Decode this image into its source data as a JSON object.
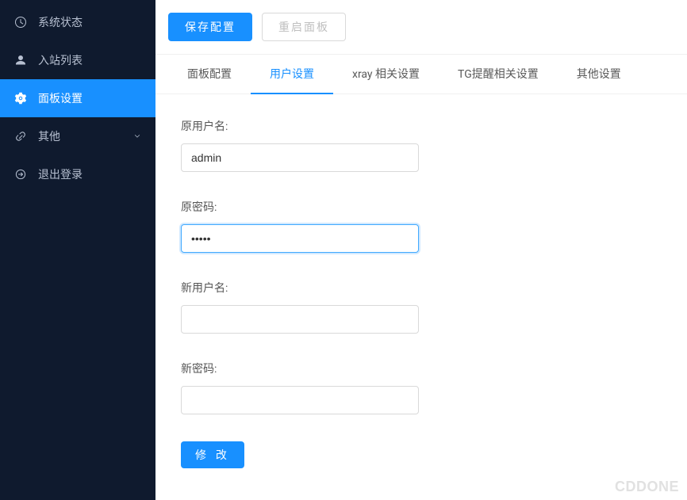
{
  "sidebar": {
    "items": [
      {
        "label": "系统状态",
        "icon": "dashboard"
      },
      {
        "label": "入站列表",
        "icon": "user"
      },
      {
        "label": "面板设置",
        "icon": "gear"
      },
      {
        "label": "其他",
        "icon": "link",
        "hasCaret": true
      },
      {
        "label": "退出登录",
        "icon": "logout"
      }
    ],
    "activeIndex": 2
  },
  "toolbar": {
    "save_label": "保存配置",
    "restart_label": "重启面板"
  },
  "tabs": {
    "items": [
      {
        "label": "面板配置"
      },
      {
        "label": "用户设置"
      },
      {
        "label": "xray 相关设置"
      },
      {
        "label": "TG提醒相关设置"
      },
      {
        "label": "其他设置"
      }
    ],
    "activeIndex": 1
  },
  "form": {
    "old_username_label": "原用户名:",
    "old_username_value": "admin",
    "old_password_label": "原密码:",
    "old_password_value": "•••••",
    "new_username_label": "新用户名:",
    "new_username_value": "",
    "new_password_label": "新密码:",
    "new_password_value": "",
    "submit_label": "修 改"
  },
  "watermark": "CDDONE"
}
